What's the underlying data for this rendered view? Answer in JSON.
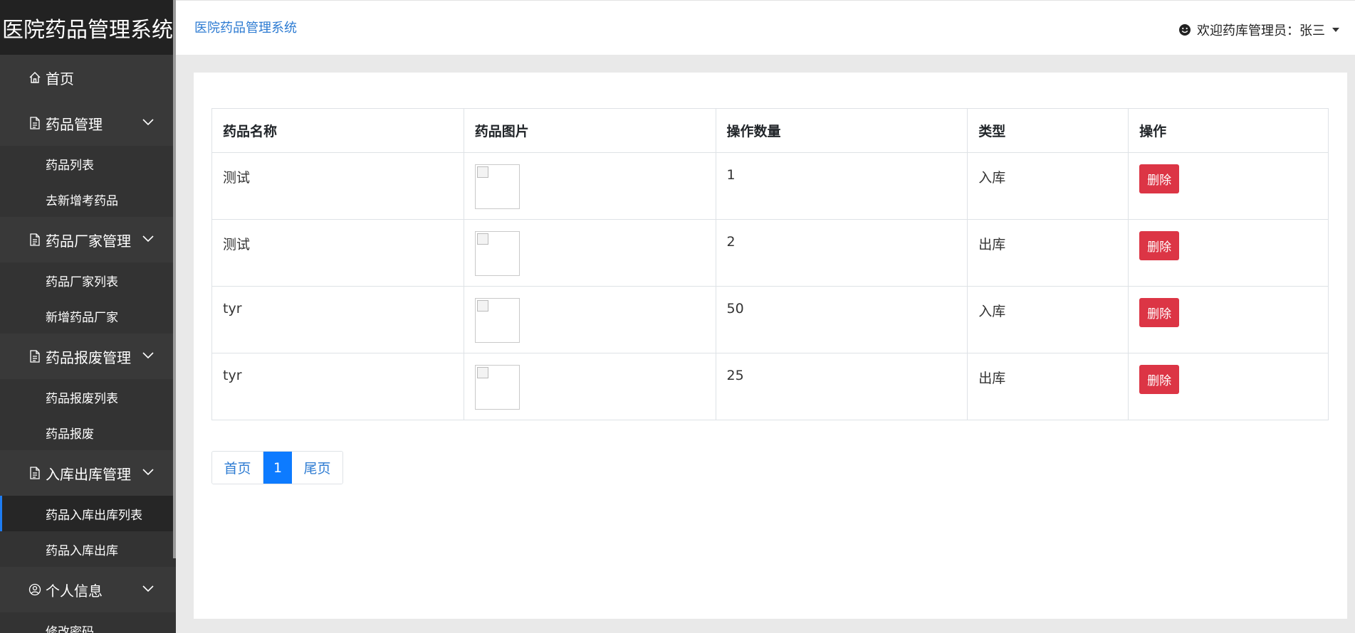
{
  "brand": "医院药品管理系统",
  "sidebar": {
    "home": "首页",
    "groups": [
      {
        "title": "药品管理",
        "items": [
          "药品列表",
          "去新增考药品"
        ]
      },
      {
        "title": "药品厂家管理",
        "items": [
          "药品厂家列表",
          "新增药品厂家"
        ]
      },
      {
        "title": "药品报废管理",
        "items": [
          "药品报废列表",
          "药品报废"
        ]
      },
      {
        "title": "入库出库管理",
        "items": [
          "药品入库出库列表",
          "药品入库出库"
        ]
      },
      {
        "title": "个人信息",
        "items": [
          "修改密码"
        ]
      }
    ],
    "active_item": "药品入库出库列表"
  },
  "header": {
    "breadcrumb": "医院药品管理系统",
    "user": "欢迎药库管理员：张三"
  },
  "table": {
    "headers": [
      "药品名称",
      "药品图片",
      "操作数量",
      "类型",
      "操作"
    ],
    "rows": [
      {
        "name": "测试",
        "qty": "1",
        "type": "入库",
        "action": "删除"
      },
      {
        "name": "测试",
        "qty": "2",
        "type": "出库",
        "action": "删除"
      },
      {
        "name": "tyr",
        "qty": "50",
        "type": "入库",
        "action": "删除"
      },
      {
        "name": "tyr",
        "qty": "25",
        "type": "出库",
        "action": "删除"
      }
    ]
  },
  "pagination": {
    "first": "首页",
    "current": "1",
    "last": "尾页"
  },
  "colors": {
    "accent": "#0d7bff",
    "danger": "#dc3545",
    "sidebar": "#393939",
    "link": "#2d7bd2"
  }
}
